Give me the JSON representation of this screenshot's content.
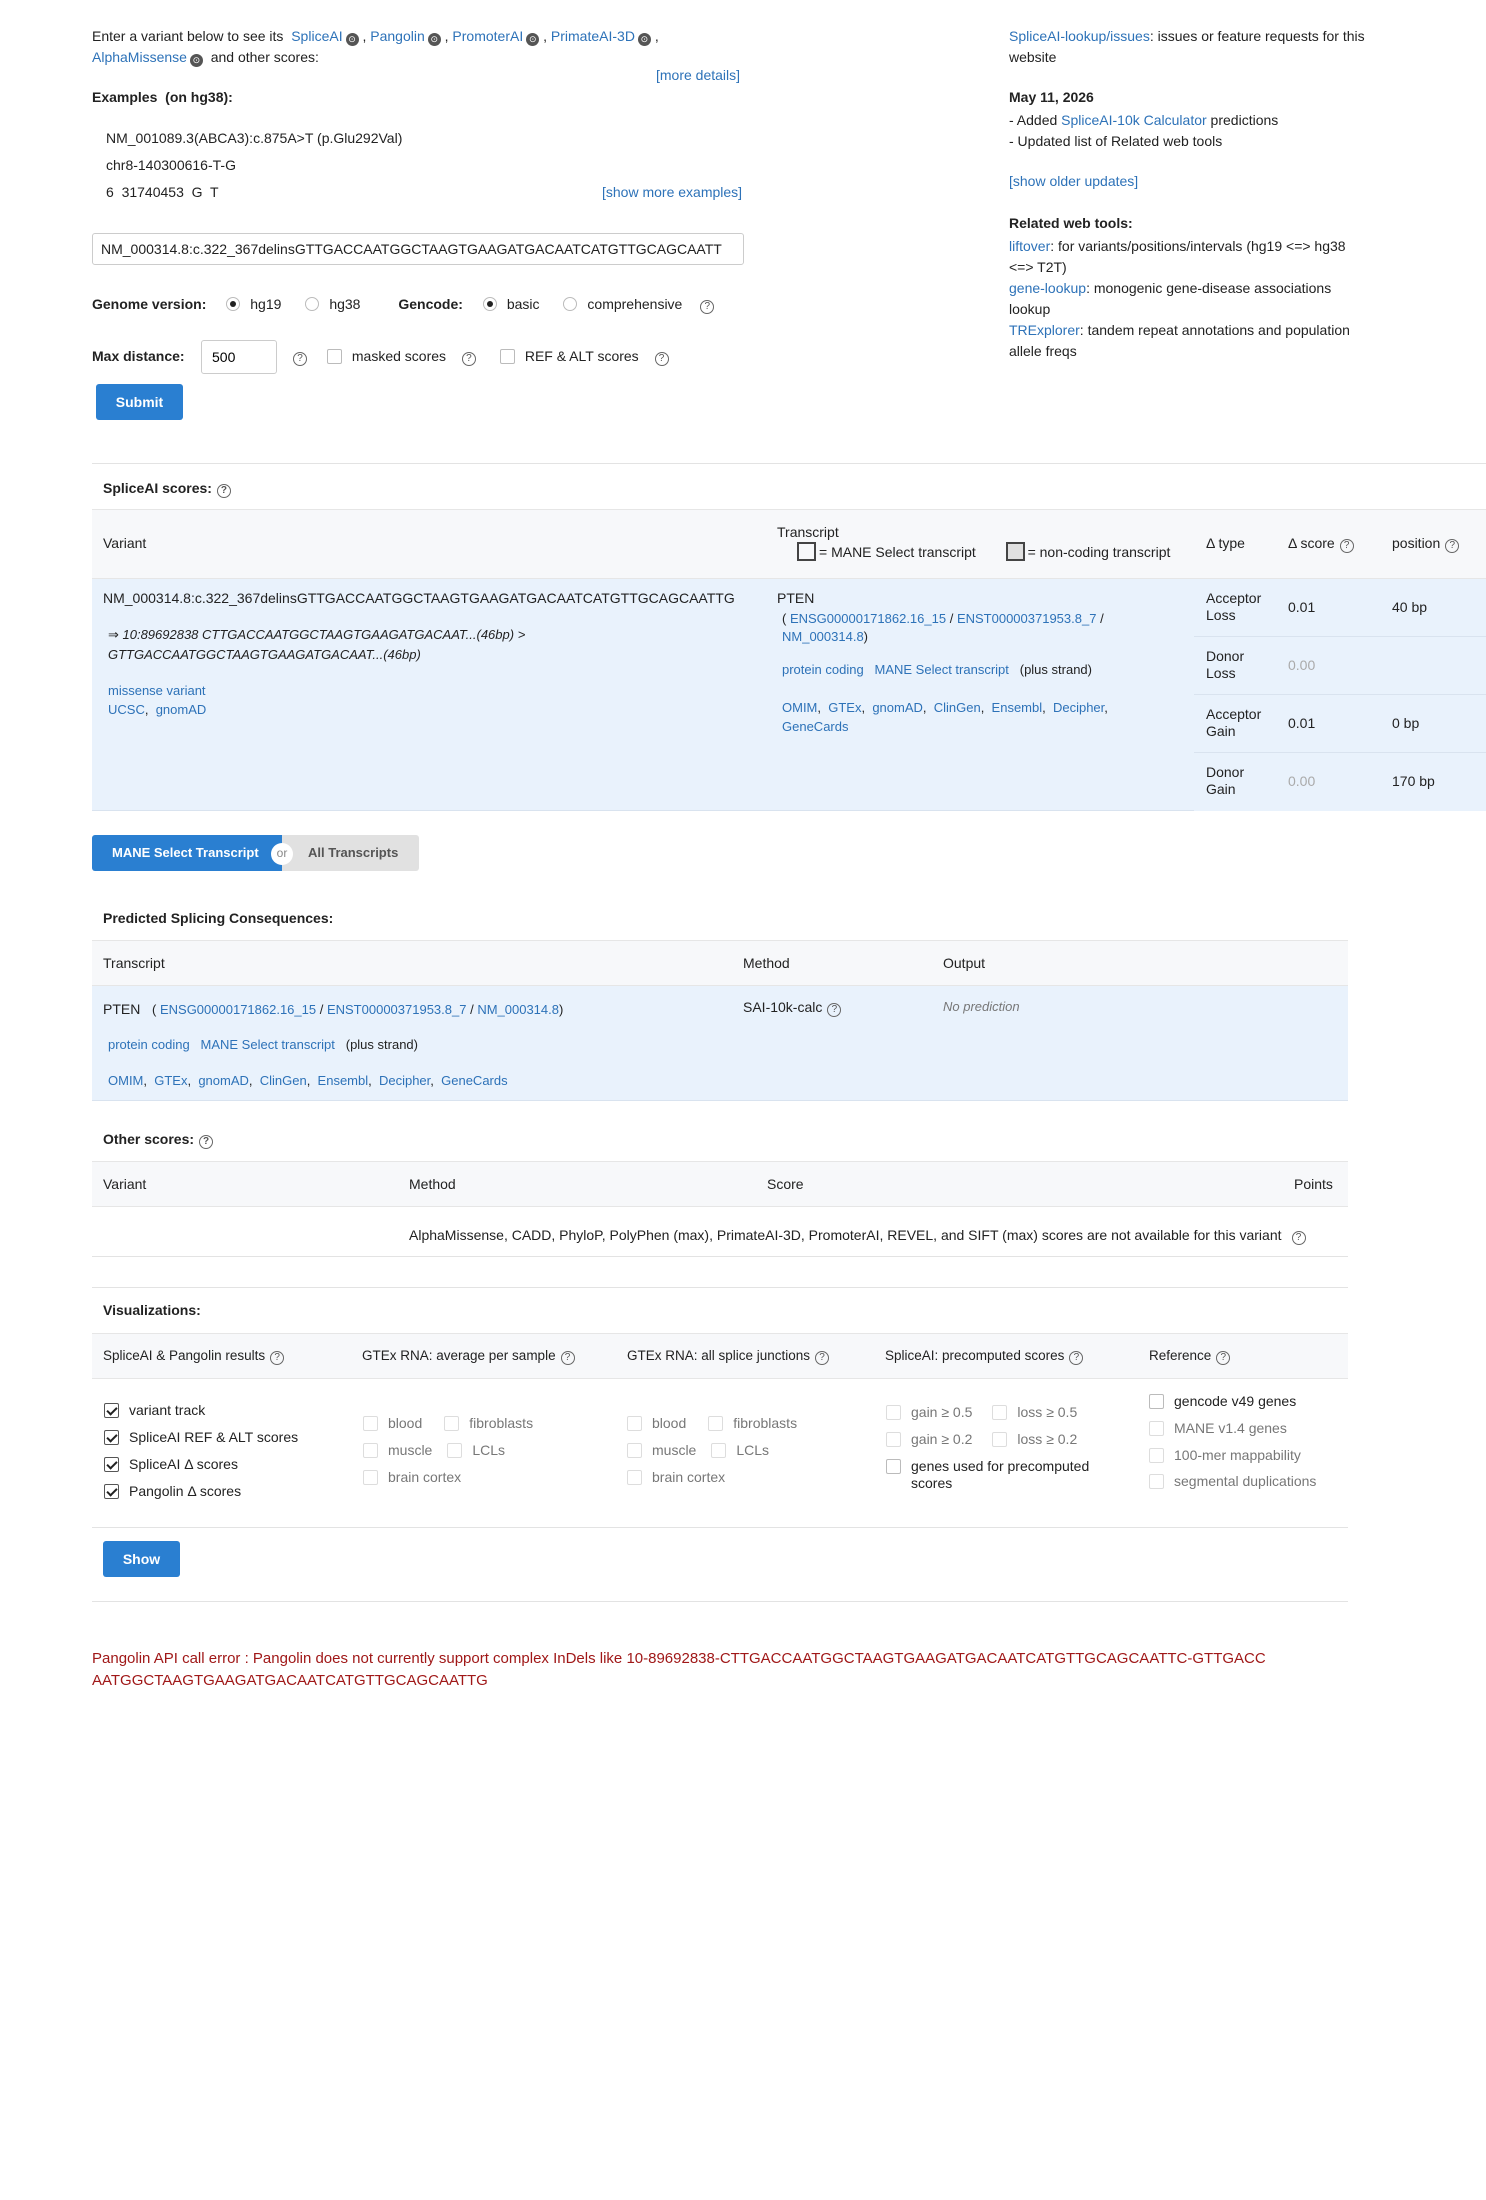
{
  "intro": {
    "text_before": "Enter a variant below to see its",
    "tools": [
      "SpliceAI",
      "Pangolin",
      "PromoterAI",
      "PrimateAI-3D",
      "AlphaMissense"
    ],
    "text_after": "and other scores:",
    "more_details": "[more details]",
    "github_glyph": "⊙"
  },
  "examples": {
    "heading": "Examples",
    "build": "(on hg38):",
    "items": [
      "NM_001089.3(ABCA3):c.875A>T (p.Glu292Val)",
      "chr8-140300616-T-G",
      "6  31740453  G  T"
    ],
    "show_more": "[show more examples]"
  },
  "query": {
    "value": "NM_000314.8:c.322_367delinsGTTGACCAATGGCTAAGTGAAGATGACAATCATGTTGCAGCAATT"
  },
  "options": {
    "genome_label": "Genome version:",
    "genome_options": [
      "hg19",
      "hg38"
    ],
    "gencode_label": "Gencode:",
    "gencode_options": [
      "basic",
      "comprehensive"
    ],
    "max_distance_label": "Max distance:",
    "max_distance_value": "500",
    "masked_label": "masked scores",
    "refalt_label": "REF & ALT scores",
    "submit": "Submit",
    "help_glyph": "?"
  },
  "sidebar": {
    "issues_link": "SpliceAI-lookup/issues",
    "issues_text": ": issues or feature requests for this website",
    "date": "May 11, 2026",
    "update1_pre": "- Added ",
    "update1_link": "SpliceAI-10k Calculator",
    "update1_post": " predictions",
    "update2": "- Updated list of Related web tools",
    "show_older": "[show older updates]",
    "related_heading": "Related web tools:",
    "related": [
      {
        "link": "liftover",
        "text": ": for variants/positions/intervals (hg19 <=> hg38 <=> T2T)"
      },
      {
        "link": "gene-lookup",
        "text": ": monogenic gene-disease associations lookup"
      },
      {
        "link": "TRExplorer",
        "text": ": tandem repeat annotations and population allele freqs"
      }
    ]
  },
  "spliceai": {
    "heading": "SpliceAI scores:",
    "col_variant": "Variant",
    "col_transcript": "Transcript",
    "legend_mane": "= MANE Select transcript",
    "legend_noncoding": "= non-coding transcript",
    "col_type": "Δ type",
    "col_score": "Δ score",
    "col_position": "position",
    "variant": "NM_000314.8:c.322_367delinsGTTGACCAATGGCTAAGTGAAGATGACAATCATGTTGCAGCAATTG",
    "conversion_line1": "⇒ 10:89692838 CTTGACCAATGGCTAAGTGAAGATGACAAT...(46bp) >",
    "conversion_line2": "GTTGACCAATGGCTAAGTGAAGATGACAAT...(46bp)",
    "consequence": "missense variant",
    "var_links": [
      "UCSC",
      "gnomAD"
    ],
    "gene": "PTEN",
    "ids": [
      "ENSG00000171862.16_15",
      "ENST00000371953.8_7",
      "NM_000314.8"
    ],
    "biotype": "protein coding",
    "mane_tag": "MANE Select transcript",
    "strand": "(plus strand)",
    "gene_links": [
      "OMIM",
      "GTEx",
      "gnomAD",
      "ClinGen",
      "Ensembl",
      "Decipher",
      "GeneCards"
    ],
    "rows": [
      {
        "type": "Acceptor Loss",
        "score": "0.01",
        "position": "40 bp"
      },
      {
        "type": "Donor Loss",
        "score": "0.00",
        "position": ""
      },
      {
        "type": "Acceptor Gain",
        "score": "0.01",
        "position": "0 bp"
      },
      {
        "type": "Donor Gain",
        "score": "0.00",
        "position": "170 bp"
      }
    ]
  },
  "toggle": {
    "mane": "MANE Select Transcript",
    "or": "or",
    "all": "All Transcripts"
  },
  "consequences": {
    "heading": "Predicted Splicing Consequences:",
    "col_transcript": "Transcript",
    "col_method": "Method",
    "col_output": "Output",
    "gene": "PTEN",
    "ids": [
      "ENSG00000171862.16_15",
      "ENST00000371953.8_7",
      "NM_000314.8"
    ],
    "biotype": "protein coding",
    "mane_tag": "MANE Select transcript",
    "strand": "(plus strand)",
    "links": [
      "OMIM",
      "GTEx",
      "gnomAD",
      "ClinGen",
      "Ensembl",
      "Decipher",
      "GeneCards"
    ],
    "method": "SAI-10k-calc",
    "output": "No prediction"
  },
  "other": {
    "heading": "Other scores:",
    "col_variant": "Variant",
    "col_method": "Method",
    "col_score": "Score",
    "col_points": "Points",
    "message": "AlphaMissense,  CADD,  PhyloP,  PolyPhen (max),  PrimateAI-3D,  PromoterAI,  REVEL,  and SIFT (max) scores are not available for this variant"
  },
  "viz": {
    "heading": "Visualizations:",
    "cols": [
      "SpliceAI & Pangolin results",
      "GTEx RNA: average per sample",
      "GTEx RNA: all splice junctions",
      "SpliceAI: precomputed scores",
      "Reference"
    ],
    "spliceai_items": [
      "variant track",
      "SpliceAI REF & ALT scores",
      "SpliceAI Δ  scores",
      "Pangolin Δ  scores"
    ],
    "gtex_tissues": [
      "blood",
      "fibroblasts",
      "muscle",
      "LCLs",
      "brain cortex"
    ],
    "precomputed": [
      "gain ≥ 0.5",
      "loss ≥ 0.5",
      "gain ≥ 0.2",
      "loss ≥ 0.2"
    ],
    "precomputed_genes": "genes used for precomputed scores",
    "reference": [
      "gencode v49 genes",
      "MANE v1.4 genes",
      "100-mer mappability",
      "segmental duplications"
    ],
    "show": "Show"
  },
  "error": {
    "text": "Pangolin API call error : Pangolin does not currently support complex InDels like 10-89692838-CTTGACCAATGGCTAAGTGAAGATGACAATCATGTTGCAGCAATTC-GTTGACCAATGGCTAAGTGAAGATGACAATCATGTTGCAGCAATTG"
  }
}
